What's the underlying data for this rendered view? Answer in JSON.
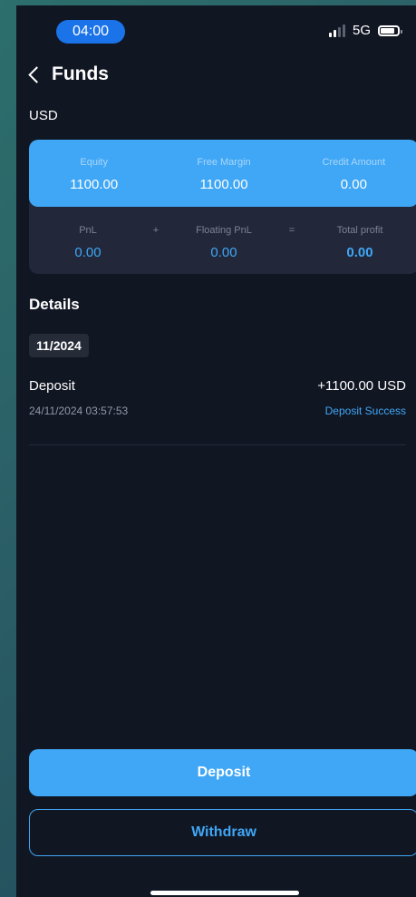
{
  "status_bar": {
    "time": "04:00",
    "network": "5G"
  },
  "header": {
    "title": "Funds"
  },
  "currency": "USD",
  "summary": {
    "equity_label": "Equity",
    "equity_value": "1100.00",
    "free_margin_label": "Free Margin",
    "free_margin_value": "1100.00",
    "credit_label": "Credit Amount",
    "credit_value": "0.00",
    "pnl_label": "PnL",
    "pnl_value": "0.00",
    "plus_sign": "+",
    "floating_label": "Floating PnL",
    "floating_value": "0.00",
    "equals_sign": "=",
    "total_label": "Total profit",
    "total_value": "0.00"
  },
  "details": {
    "title": "Details",
    "month": "11/2024",
    "transactions": [
      {
        "type": "Deposit",
        "amount": "+1100.00 USD",
        "datetime": "24/11/2024 03:57:53",
        "status": "Deposit Success"
      }
    ]
  },
  "actions": {
    "deposit_label": "Deposit",
    "withdraw_label": "Withdraw"
  },
  "colors": {
    "accent": "#3fa7f5",
    "background": "#111623",
    "card": "#22283a",
    "time_pill": "#1a73e8"
  }
}
